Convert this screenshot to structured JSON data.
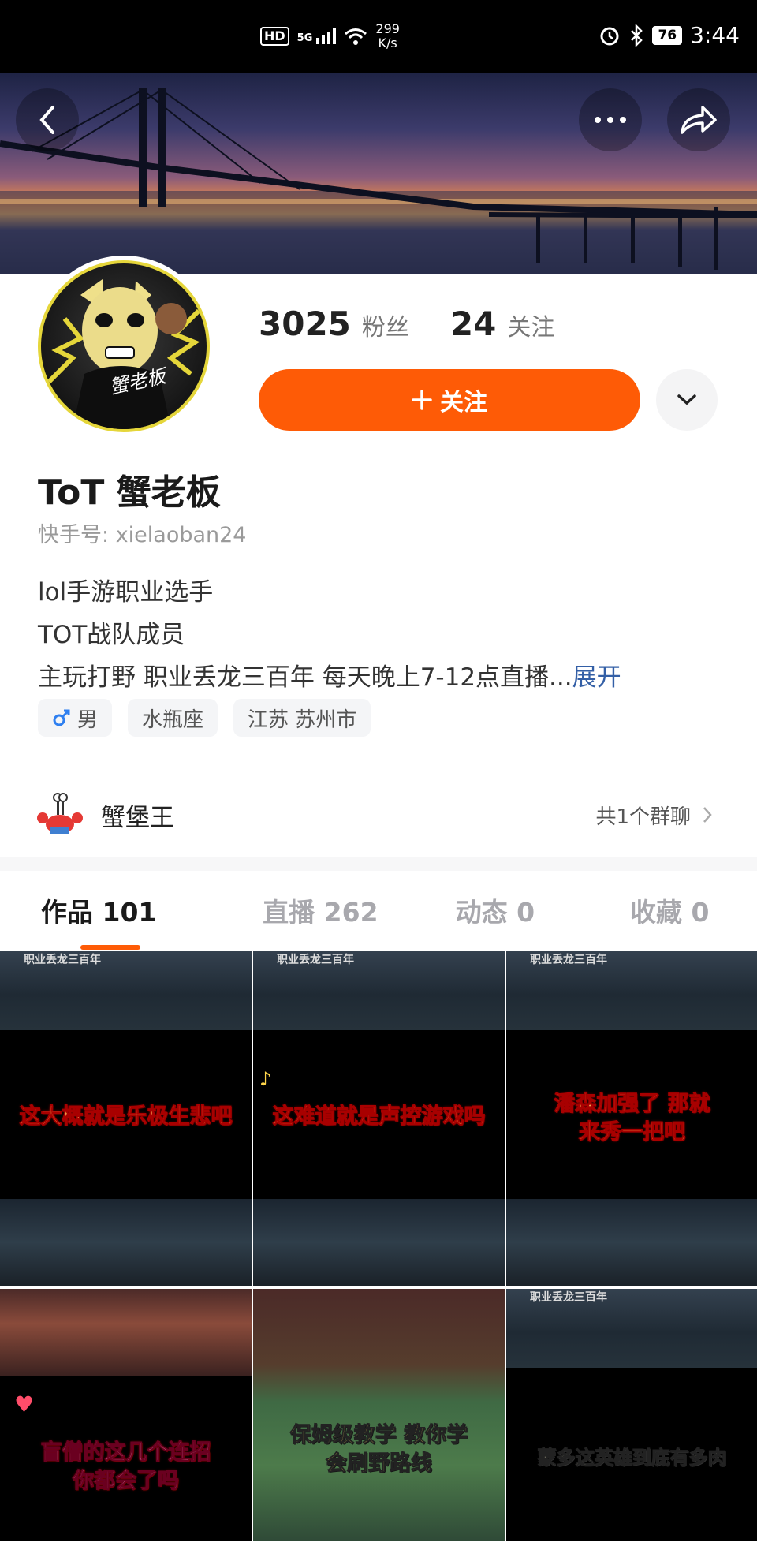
{
  "status_bar": {
    "network_badge": "HD",
    "signal": "5G",
    "net_speed_value": "299",
    "net_speed_unit": "K/s",
    "battery": "76",
    "time": "3:44"
  },
  "header": {
    "back_icon": "back-arrow-icon",
    "more_icon": "more-dots-icon",
    "share_icon": "share-arrow-icon"
  },
  "profile": {
    "fans_count": "3025",
    "fans_label": "粉丝",
    "following_count": "24",
    "following_label": "关注",
    "follow_button_label": "关注",
    "name": "ToT 蟹老板",
    "kuaishou_id": "快手号: xielaoban24",
    "bio_line1": "lol手游职业选手",
    "bio_line2": "TOT战队成员",
    "bio_line3": "主玩打野 职业丢龙三百年 每天晚上7-12点直播...",
    "bio_expand": "展开",
    "avatar_text": "蟹老板",
    "tags": [
      "男",
      "水瓶座",
      "江苏 苏州市"
    ]
  },
  "group": {
    "name": "蟹堡王",
    "count_label": "共1个群聊"
  },
  "tabs": [
    {
      "label": "作品 101",
      "active": true
    },
    {
      "label": "直播 262",
      "active": false
    },
    {
      "label": "动态 0",
      "active": false
    },
    {
      "label": "收藏 0",
      "active": false
    }
  ],
  "videos": {
    "top_label": "职业丢龙三百年",
    "captions": [
      "这大概就是乐极生悲吧",
      "这难道就是声控游戏吗",
      "潘森加强了 那就来秀一把吧",
      "盲僧的这几个连招 你都会了吗",
      "保姆级教学 教你学会刷野路线",
      "蒙多这英雄到底有多肉"
    ]
  },
  "colors": {
    "accent": "#fe5b06",
    "link": "#335fa6"
  }
}
